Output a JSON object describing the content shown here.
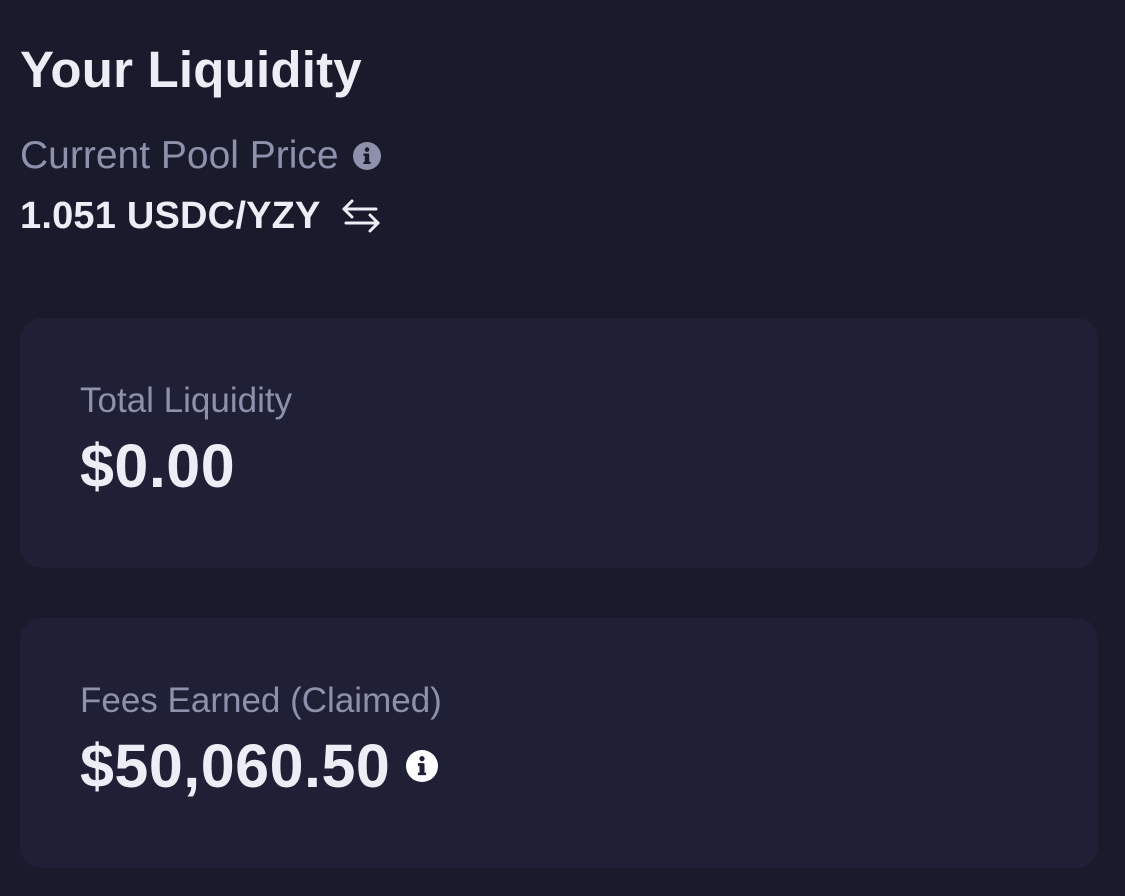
{
  "header": {
    "title": "Your Liquidity"
  },
  "pool_price": {
    "label": "Current Pool Price",
    "value": "1.051 USDC/YZY",
    "label_icon": "info-icon",
    "toggle_icon": "swap-arrows-icon"
  },
  "cards": {
    "total_liquidity": {
      "label": "Total Liquidity",
      "value": "$0.00"
    },
    "fees_earned": {
      "label": "Fees Earned (Claimed)",
      "value": "$50,060.50",
      "value_icon": "info-icon"
    }
  },
  "colors": {
    "background": "#191a2c",
    "card": "#1f2036",
    "text_primary": "#eceef6",
    "text_secondary": "#8e91ab"
  }
}
